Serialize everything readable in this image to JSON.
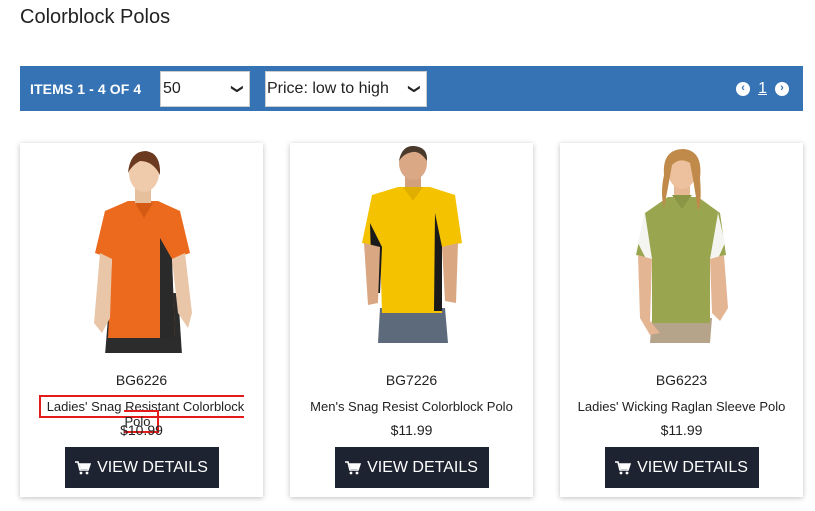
{
  "page": {
    "title": "Colorblock Polos"
  },
  "toolbar": {
    "items_label": "ITEMS 1 - 4 OF 4",
    "per_page": "50",
    "sort": "Price: low to high",
    "current_page": "1"
  },
  "products": [
    {
      "sku": "BG6226",
      "name": "Ladies' Snag Resistant Colorblock Polo",
      "price": "$10.99",
      "button": "VIEW DETAILS",
      "shirt_color": "#ec6a1e",
      "panel_color": "#2a2a2a"
    },
    {
      "sku": "BG7226",
      "name": "Men's Snag Resist Colorblock Polo",
      "price": "$11.99",
      "button": "VIEW DETAILS",
      "shirt_color": "#f5c200",
      "panel_color": "#1a1a1a"
    },
    {
      "sku": "BG6223",
      "name": "Ladies' Wicking Raglan Sleeve Polo",
      "price": "$11.99",
      "button": "VIEW DETAILS",
      "shirt_color": "#9aa64f",
      "panel_color": "#f4f4f0"
    }
  ],
  "colors": {
    "toolbar": "#3573b4",
    "button": "#1e2331",
    "highlight": "#e31b1b"
  }
}
